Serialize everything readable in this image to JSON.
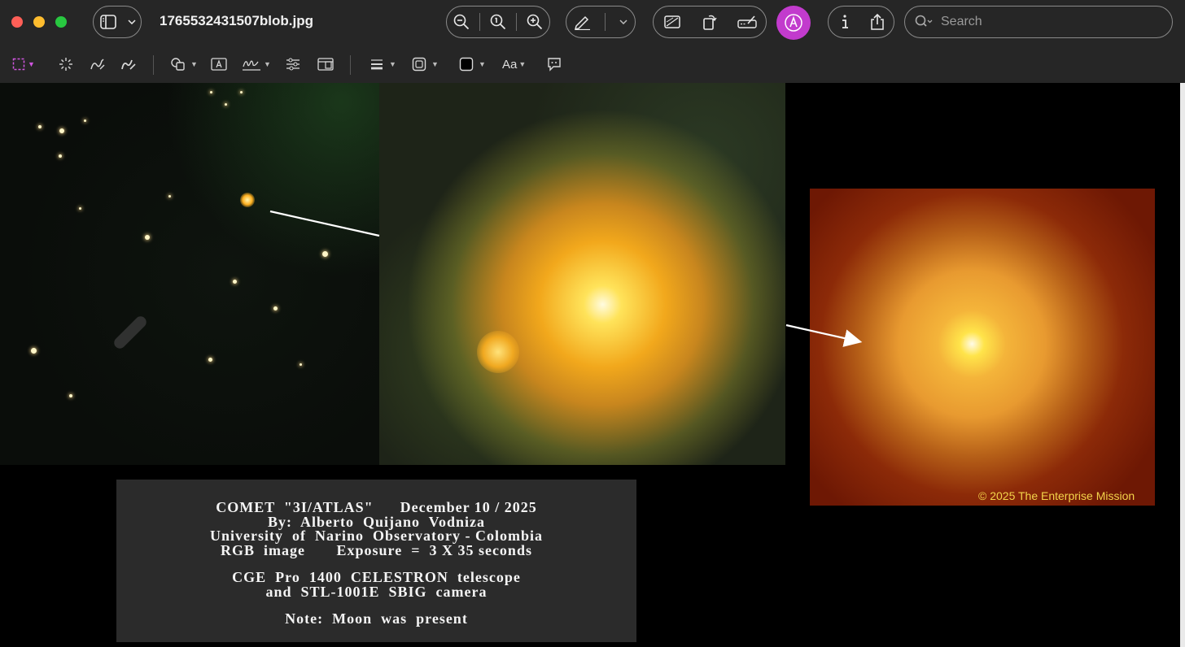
{
  "window": {
    "title": "1765532431507blob.jpg",
    "traffic_lights": [
      "close",
      "minimize",
      "zoom"
    ]
  },
  "titlebar": {
    "sidebar_toggle_icon": "sidebar-icon",
    "zoom_out_icon": "zoom-out-icon",
    "actual_size_icon": "actual-size-icon",
    "zoom_in_icon": "zoom-in-icon",
    "highlight_icon": "pen-icon",
    "crop_icon": "crop-icon",
    "rotate_icon": "rotate-icon",
    "markup_icon": "markup-icon",
    "info_icon": "info-icon",
    "share_icon": "share-icon",
    "search_placeholder": "Search"
  },
  "toolbar": {
    "font_label": "Aa",
    "items": [
      "selection",
      "instant-alpha",
      "sketch",
      "draw",
      "shapes",
      "text",
      "sign",
      "adjust-color",
      "adjust-size",
      "shape-style",
      "border-color",
      "fill-color",
      "text-style",
      "annotate"
    ]
  },
  "image": {
    "copyright": "© 2025 The Enterprise Mission",
    "caption_lines": [
      "COMET  \"3I/ATLAS\"      December 10 / 2025",
      "By:  Alberto  Quijano  Vodniza",
      "University  of  Narino  Observatory - Colombia",
      "RGB  image       Exposure  =  3 X 35 seconds",
      "CGE  Pro  1400  CELESTRON  telescope",
      "and  STL-1001E  SBIG  camera",
      "Note:  Moon  was  present"
    ]
  },
  "colors": {
    "titlebar_bg": "#262626",
    "markup_accent": "#c23bcd",
    "copyright_text": "#f3d34a",
    "caption_bg": "#2b2b2b"
  }
}
